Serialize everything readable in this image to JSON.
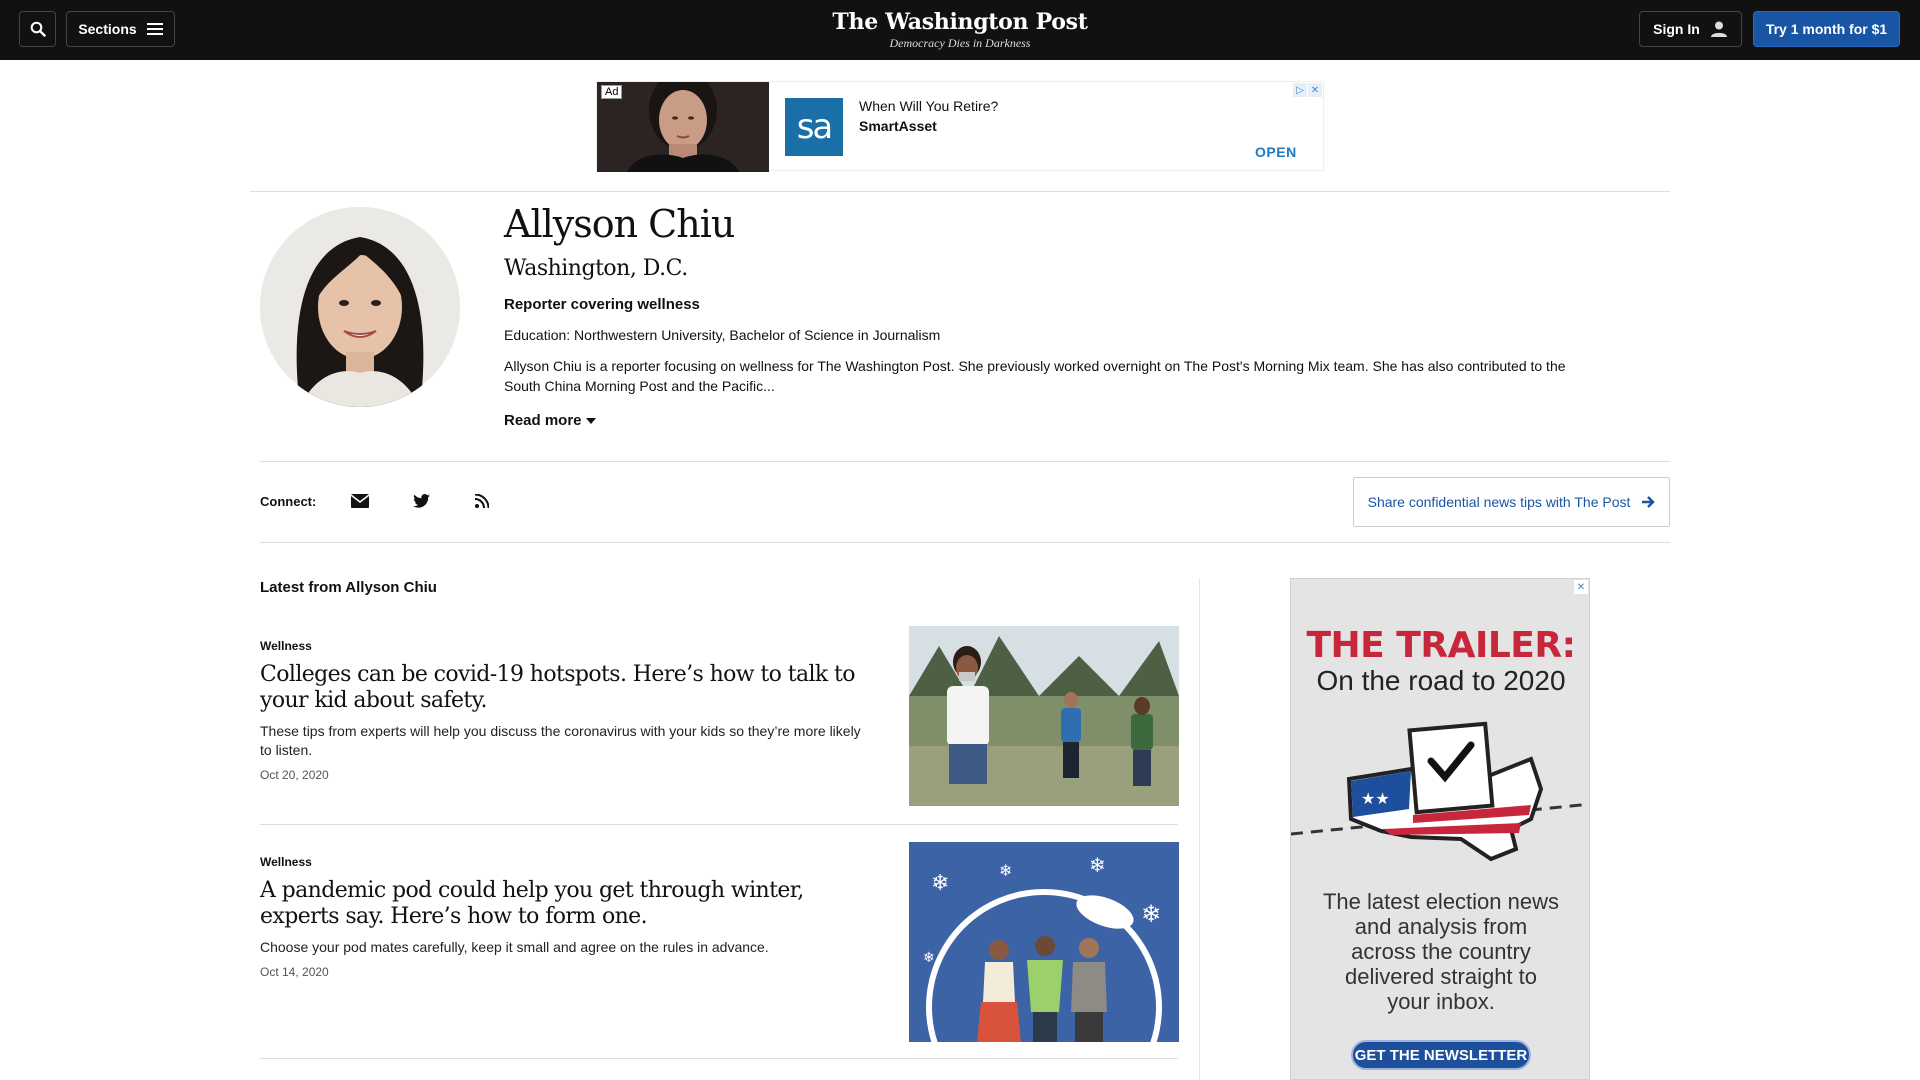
{
  "nav": {
    "sections_label": "Sections",
    "signin_label": "Sign In",
    "try_label": "Try 1 month for $1",
    "logo_text": "The Washington Post",
    "tagline": "Democracy Dies in Darkness"
  },
  "top_ad": {
    "ad_tag": "Ad",
    "logo_text": "sa",
    "question": "When Will You Retire?",
    "brand": "SmartAsset",
    "cta": "OPEN"
  },
  "author": {
    "name": "Allyson Chiu",
    "location": "Washington, D.C.",
    "role": "Reporter covering wellness",
    "education": "Education: Northwestern University, Bachelor of Science in Journalism",
    "bio": "Allyson Chiu is a reporter focusing on wellness for The Washington Post. She previously worked overnight on The Post's Morning Mix team. She has also contributed to the South China Morning Post and the Pacific...",
    "read_more": "Read more"
  },
  "connect": {
    "label": "Connect:",
    "icons": [
      "email-icon",
      "twitter-icon",
      "rss-icon"
    ],
    "tips_label": "Share confidential news tips with The Post"
  },
  "latest": {
    "label": "Latest from Allyson Chiu",
    "articles": [
      {
        "kicker": "Wellness",
        "headline": "Colleges can be covid-19 hotspots. Here’s how to talk to your kid about safety.",
        "blurb": "These tips from experts will help you discuss the coronavirus with your kids so they’re more likely to listen.",
        "date": "Oct 20, 2020"
      },
      {
        "kicker": "Wellness",
        "headline": "A pandemic pod could help you get through winter, experts say. Here’s how to form one.",
        "blurb": "Choose your pod mates carefully, keep it small and agree on the rules in advance.",
        "date": "Oct 14, 2020"
      }
    ]
  },
  "side_ad": {
    "title": "THE TRAILER:",
    "subtitle": "On the road to 2020",
    "body": "The latest election news and analysis from across the country delivered straight to your inbox.",
    "cta": "GET THE NEWSLETTER"
  },
  "colors": {
    "nav_bg": "#111111",
    "accent_blue": "#1955a5",
    "trailer_red": "#c8263b"
  }
}
